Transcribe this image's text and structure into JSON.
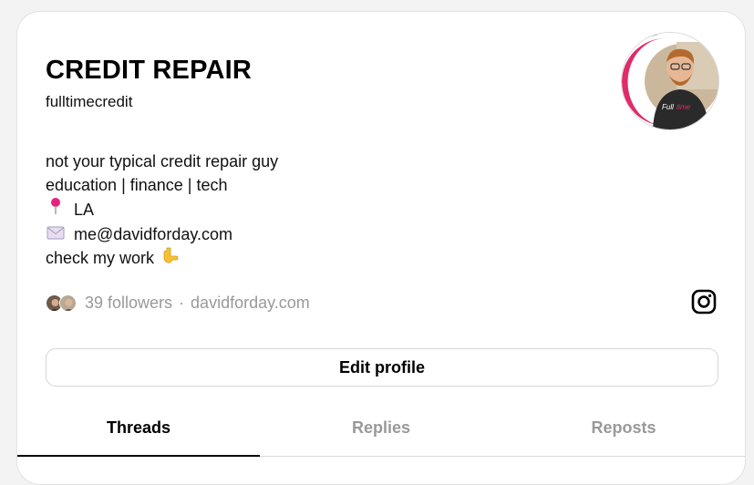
{
  "profile": {
    "name": "CREDIT REPAIR",
    "username": "fulltimecredit"
  },
  "bio": {
    "line1": "not your typical credit repair guy",
    "line2": "education | finance | tech",
    "location_emoji": "📍",
    "location": "LA",
    "email_emoji": "✉️",
    "email": "me@davidforday.com",
    "cta": "check my work",
    "cta_emoji": "👇"
  },
  "meta": {
    "followers": "39 followers",
    "separator": "·",
    "link": "davidforday.com"
  },
  "actions": {
    "edit_profile": "Edit profile"
  },
  "tabs": [
    {
      "label": "Threads",
      "active": true
    },
    {
      "label": "Replies",
      "active": false
    },
    {
      "label": "Reposts",
      "active": false
    }
  ],
  "icons": {
    "social": "instagram-icon"
  },
  "colors": {
    "text": "#000000",
    "muted": "#999999",
    "border": "#d6d6d6",
    "active_tab": "#000000"
  }
}
